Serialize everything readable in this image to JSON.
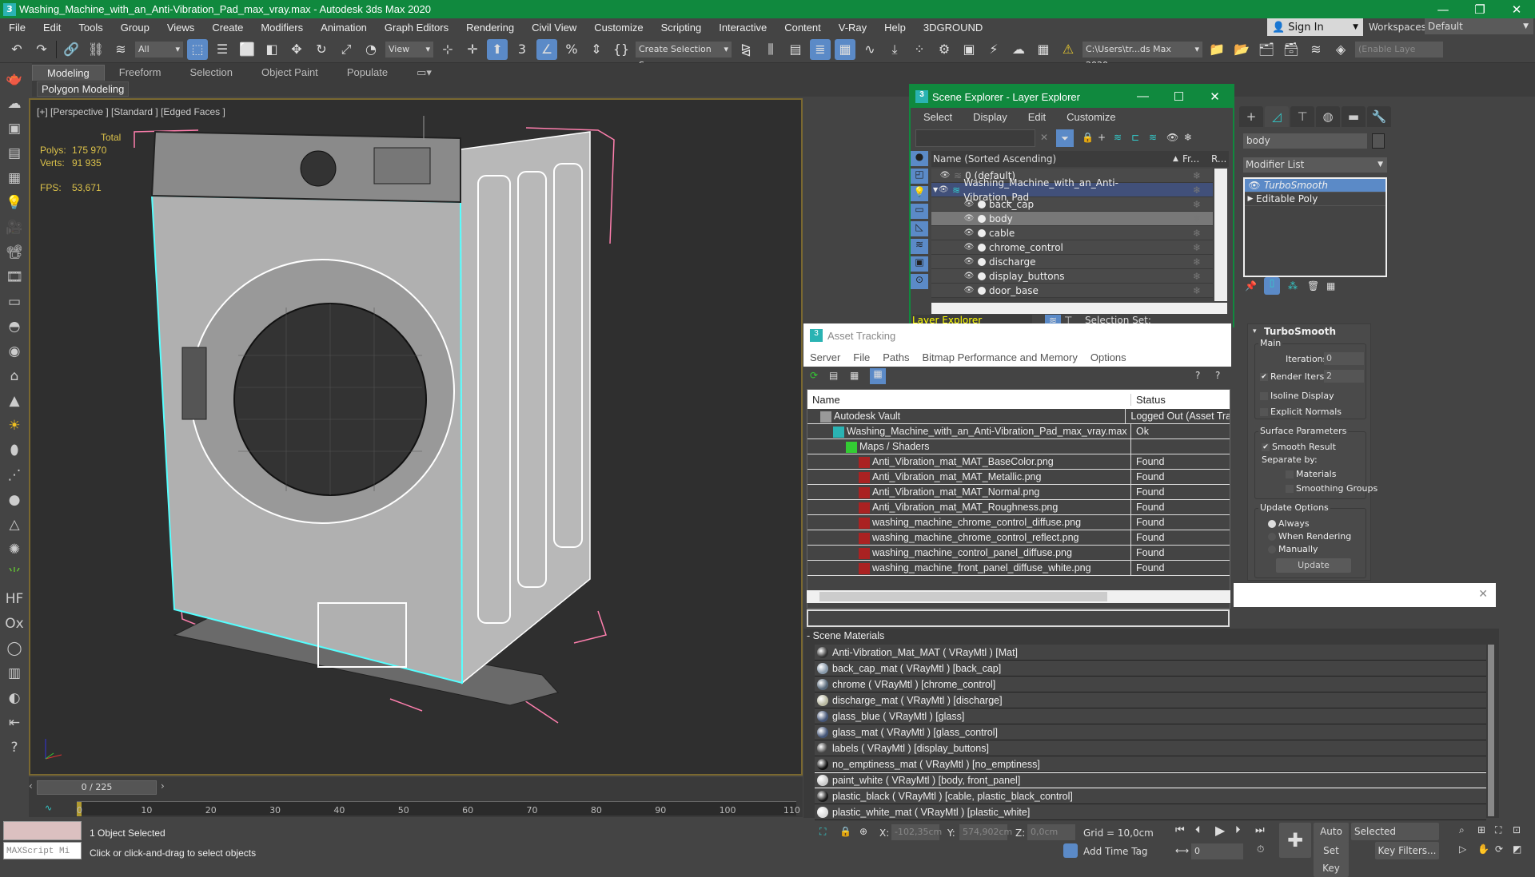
{
  "window": {
    "title": "Washing_Machine_with_an_Anti-Vibration_Pad_max_vray.max - Autodesk 3ds Max 2020",
    "app_icon": "3"
  },
  "menu": [
    "File",
    "Edit",
    "Tools",
    "Group",
    "Views",
    "Create",
    "Modifiers",
    "Animation",
    "Graph Editors",
    "Rendering",
    "Civil View",
    "Customize",
    "Scripting",
    "Interactive",
    "Content",
    "V-Ray",
    "Help",
    "3DGROUND"
  ],
  "account": {
    "sign_in": "Sign In",
    "workspaces_label": "Workspaces:",
    "workspace": "Default"
  },
  "toolbar": {
    "selection_filter": "All",
    "ref_coord": "View",
    "named_selection": "Create Selection Se",
    "project_path": "C:\\Users\\tr...ds Max 2020",
    "layer_field": "(Enable Laye"
  },
  "ribbon": {
    "tabs": [
      "Modeling",
      "Freeform",
      "Selection",
      "Object Paint",
      "Populate"
    ],
    "active_tab": "Modeling",
    "panel": "Polygon Modeling"
  },
  "viewport": {
    "label": "[+] [Perspective ] [Standard ] [Edged Faces ]",
    "stats": {
      "header": "Total",
      "polys_label": "Polys:",
      "polys": "175 970",
      "verts_label": "Verts:",
      "verts": "91 935",
      "fps_label": "FPS:",
      "fps": "53,671"
    }
  },
  "timeline": {
    "frame": "0 / 225",
    "current_frame": 0,
    "total_frames": 225,
    "ticks": [
      "0",
      "10",
      "20",
      "30",
      "40",
      "50",
      "60",
      "70",
      "80",
      "90",
      "100",
      "110"
    ]
  },
  "status": {
    "selected": "1 Object Selected",
    "prompt": "Click or click-and-drag to select objects",
    "maxscript": "MAXScript Mi"
  },
  "coords": {
    "x_label": "X:",
    "x": "-102,35cm",
    "y_label": "Y:",
    "y": "574,902cm",
    "z_label": "Z:",
    "z": "0,0cm",
    "grid": "Grid = 10,0cm",
    "add_time_tag": "Add Time Tag"
  },
  "anim": {
    "auto_key": "Auto Key",
    "set_key": "Set Key",
    "key_mode": "Selected",
    "key_filters": "Key Filters...",
    "frame_field": "0"
  },
  "scene_explorer": {
    "title": "Scene Explorer - Layer Explorer",
    "menu": [
      "Select",
      "Display",
      "Edit",
      "Customize"
    ],
    "columns": {
      "name": "Name (Sorted Ascending)",
      "frozen": "Fr...",
      "render": "R..."
    },
    "rows": [
      {
        "name": "0 (default)",
        "type": "layer",
        "indent": 0
      },
      {
        "name": "Washing_Machine_with_an_Anti-Vibration_Pad",
        "type": "layer-active",
        "indent": 0
      },
      {
        "name": "back_cap",
        "type": "object",
        "indent": 1
      },
      {
        "name": "body",
        "type": "object",
        "indent": 1,
        "selected": true
      },
      {
        "name": "cable",
        "type": "object",
        "indent": 1
      },
      {
        "name": "chrome_control",
        "type": "object",
        "indent": 1
      },
      {
        "name": "discharge",
        "type": "object",
        "indent": 1
      },
      {
        "name": "display_buttons",
        "type": "object",
        "indent": 1
      },
      {
        "name": "door_base",
        "type": "object",
        "indent": 1
      }
    ],
    "footer_dropdown": "Layer Explorer",
    "selection_set_label": "Selection Set:"
  },
  "asset_tracking": {
    "title": "Asset Tracking",
    "menu": [
      "Server",
      "File",
      "Paths",
      "Bitmap Performance and Memory",
      "Options"
    ],
    "columns": {
      "name": "Name",
      "status": "Status"
    },
    "rows": [
      {
        "name": "Autodesk Vault",
        "status": "Logged Out (Asset Tra",
        "indent": 1,
        "icon": "vault"
      },
      {
        "name": "Washing_Machine_with_an_Anti-Vibration_Pad_max_vray.max",
        "status": "Ok",
        "indent": 2,
        "icon": "max"
      },
      {
        "name": "Maps / Shaders",
        "status": "",
        "indent": 3,
        "icon": "maps"
      },
      {
        "name": "Anti_Vibration_mat_MAT_BaseColor.png",
        "status": "Found",
        "indent": 4,
        "icon": "bitmap"
      },
      {
        "name": "Anti_Vibration_mat_MAT_Metallic.png",
        "status": "Found",
        "indent": 4,
        "icon": "bitmap"
      },
      {
        "name": "Anti_Vibration_mat_MAT_Normal.png",
        "status": "Found",
        "indent": 4,
        "icon": "bitmap"
      },
      {
        "name": "Anti_Vibration_mat_MAT_Roughness.png",
        "status": "Found",
        "indent": 4,
        "icon": "bitmap"
      },
      {
        "name": "washing_machine_chrome_control_diffuse.png",
        "status": "Found",
        "indent": 4,
        "icon": "bitmap"
      },
      {
        "name": "washing_machine_chrome_control_reflect.png",
        "status": "Found",
        "indent": 4,
        "icon": "bitmap"
      },
      {
        "name": "washing_machine_control_panel_diffuse.png",
        "status": "Found",
        "indent": 4,
        "icon": "bitmap"
      },
      {
        "name": "washing_machine_front_panel_diffuse_white.png",
        "status": "Found",
        "indent": 4,
        "icon": "bitmap"
      }
    ]
  },
  "scene_materials": {
    "header": "- Scene Materials",
    "items": [
      {
        "label": "Anti-Vibration_Mat_MAT  ( VRayMtl )  [Mat]",
        "swatch": "#333333"
      },
      {
        "label": "back_cap_mat  ( VRayMtl )  [back_cap]",
        "swatch": "#8899aa"
      },
      {
        "label": "chrome  ( VRayMtl )  [chrome_control]",
        "swatch": "#556677"
      },
      {
        "label": "discharge_mat  ( VRayMtl )  [discharge]",
        "swatch": "#b8b8a0"
      },
      {
        "label": "glass_blue  ( VRayMtl )  [glass]",
        "swatch": "#445577"
      },
      {
        "label": "glass_mat  ( VRayMtl )  [glass_control]",
        "swatch": "#445577"
      },
      {
        "label": "labels  ( VRayMtl )  [display_buttons]",
        "swatch": "#444444"
      },
      {
        "label": "no_emptiness_mat  ( VRayMtl )  [no_emptiness]",
        "swatch": "#111111"
      },
      {
        "label": "paint_white  ( VRayMtl )  [body, front_panel]",
        "swatch": "#cccccc",
        "selected": true
      },
      {
        "label": "plastic_black  ( VRayMtl )  [cable, plastic_black_control]",
        "swatch": "#1a1a1a"
      },
      {
        "label": "plastic_white_mat  ( VRayMtl )  [plastic_white]",
        "swatch": "#dddddd"
      }
    ]
  },
  "command_panel": {
    "object_name": "body",
    "modifier_list": "Modifier List",
    "stack": [
      "TurboSmooth",
      "Editable Poly"
    ],
    "rollout_title": "TurboSmooth",
    "main_group": "Main",
    "iterations_label": "Iterations:",
    "iterations": "0",
    "render_iters_label": "Render Iters:",
    "render_iters": "2",
    "render_iters_checked": true,
    "isoline_display": "Isoline Display",
    "explicit_normals": "Explicit Normals",
    "surface_group": "Surface Parameters",
    "smooth_result": "Smooth Result",
    "separate_by": "Separate by:",
    "materials": "Materials",
    "smoothing_groups": "Smoothing Groups",
    "update_group": "Update Options",
    "always": "Always",
    "when_rendering": "When Rendering",
    "manually": "Manually",
    "update_button": "Update"
  },
  "colors": {
    "title_green": "#10893e",
    "selection_blue": "#5b8ac7",
    "stats_yellow": "#dcc24a",
    "viewport_border": "#7a6830"
  }
}
